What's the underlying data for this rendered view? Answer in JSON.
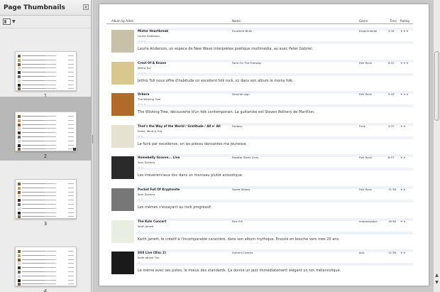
{
  "sidebar": {
    "title": "Page Thumbnails",
    "close_glyph": "x",
    "view_icon": "thumbnail-view-icon",
    "dropdown_icon": "chevron-down-icon",
    "pages": [
      {
        "number": "1",
        "selected": false
      },
      {
        "number": "2",
        "selected": true
      },
      {
        "number": "3",
        "selected": false
      },
      {
        "number": "4",
        "selected": false
      }
    ]
  },
  "document": {
    "columns": {
      "album_by_artist": "Album by Artist",
      "name": "Name",
      "genre": "Genre",
      "time": "Time",
      "rating": "Rating"
    },
    "entries": [
      {
        "title": "Mister Heartbreak",
        "artist": "Laurie Anderson",
        "stars": "☆☆☆",
        "album": "Excellent Birds",
        "genre": "Experimental",
        "time": "3:16",
        "rating": "★★★",
        "desc": "Laurie Anderson, un espèce de New Wave interprétée poétique multimédia, au avec Peter Gabriel.",
        "art_color": "#c8c0a8"
      },
      {
        "title": "Crest Of A Knave",
        "artist": "Jethro Tull",
        "stars": "☆☆☆",
        "album": "Farm On The Freeway",
        "genre": "Folk Rock",
        "time": "6:31",
        "rating": "★★★",
        "desc": "Jethro Tull nous offre d'habitude un excellent folk rock, ici dans son album le moins folk.",
        "art_color": "#d8c890"
      },
      {
        "title": "Orbera",
        "artist": "The Wishing Tree",
        "stars": "☆☆☆",
        "album": "Seventh sign",
        "genre": "Folk Rock",
        "time": "5:43",
        "rating": "★★★",
        "desc": "The Wishing Tree, découverte d'un folk contemporain. La guitariste est Steven Rothery de Marillion.",
        "art_color": "#b06a2a"
      },
      {
        "title": "That's the Way of the World / Gratitude / All n' All",
        "artist": "Earth, Wind & Fire",
        "stars": "☆☆",
        "album": "Fantasy",
        "genre": "Funk",
        "time": "4:37",
        "rating": "★★",
        "desc": "Le funk par excellence, en les pièces dansantes ma jeunesse.",
        "art_color": "#e6e2d2"
      },
      {
        "title": "Homebelly Groove... Live",
        "artist": "Spin Doctors",
        "stars": "☆☆",
        "album": "Rosetta Stone (live)",
        "genre": "Folk Rock",
        "time": "8:57",
        "rating": "★★",
        "desc": "Les irrévérencieux doc dans un morceau plutôt acoustique.",
        "art_color": "#2a2a2a"
      },
      {
        "title": "Pocket Full Of Kryptonite",
        "artist": "Spin Doctors",
        "stars": "☆☆",
        "album": "Sweet Widow",
        "genre": "Folk Rock",
        "time": "11:38",
        "rating": "★★",
        "desc": "Les mêmes s'essayant au rock progressif.",
        "art_color": "#777777"
      },
      {
        "title": "The Koln Concert",
        "artist": "Keith Jarrett",
        "stars": "☆",
        "album": "Part II B",
        "genre": "Improvisation",
        "time": "18:38",
        "rating": "★★",
        "desc": "Keith Jarrett, le créatif à l'incomparable caractère, dans son album mythique. Enouté en bouche vers mes 20 ans.",
        "art_color": "#e8eee2"
      },
      {
        "title": "Still Live (Disc 2)",
        "artist": "Keith Jarrett Trio",
        "stars": "☆",
        "album": "Autumn Leaves",
        "genre": "Jazz",
        "time": "11:38",
        "rating": "★★",
        "desc": "Le même avec ses potes, le mieux des standards. Ça donne un jazz immédiatement élégant un ton mélancolique.",
        "art_color": "#1a1a1a"
      }
    ]
  },
  "scrollbar": {
    "up_icon": "arrow-up-icon",
    "down_icon": "arrow-down-icon"
  }
}
